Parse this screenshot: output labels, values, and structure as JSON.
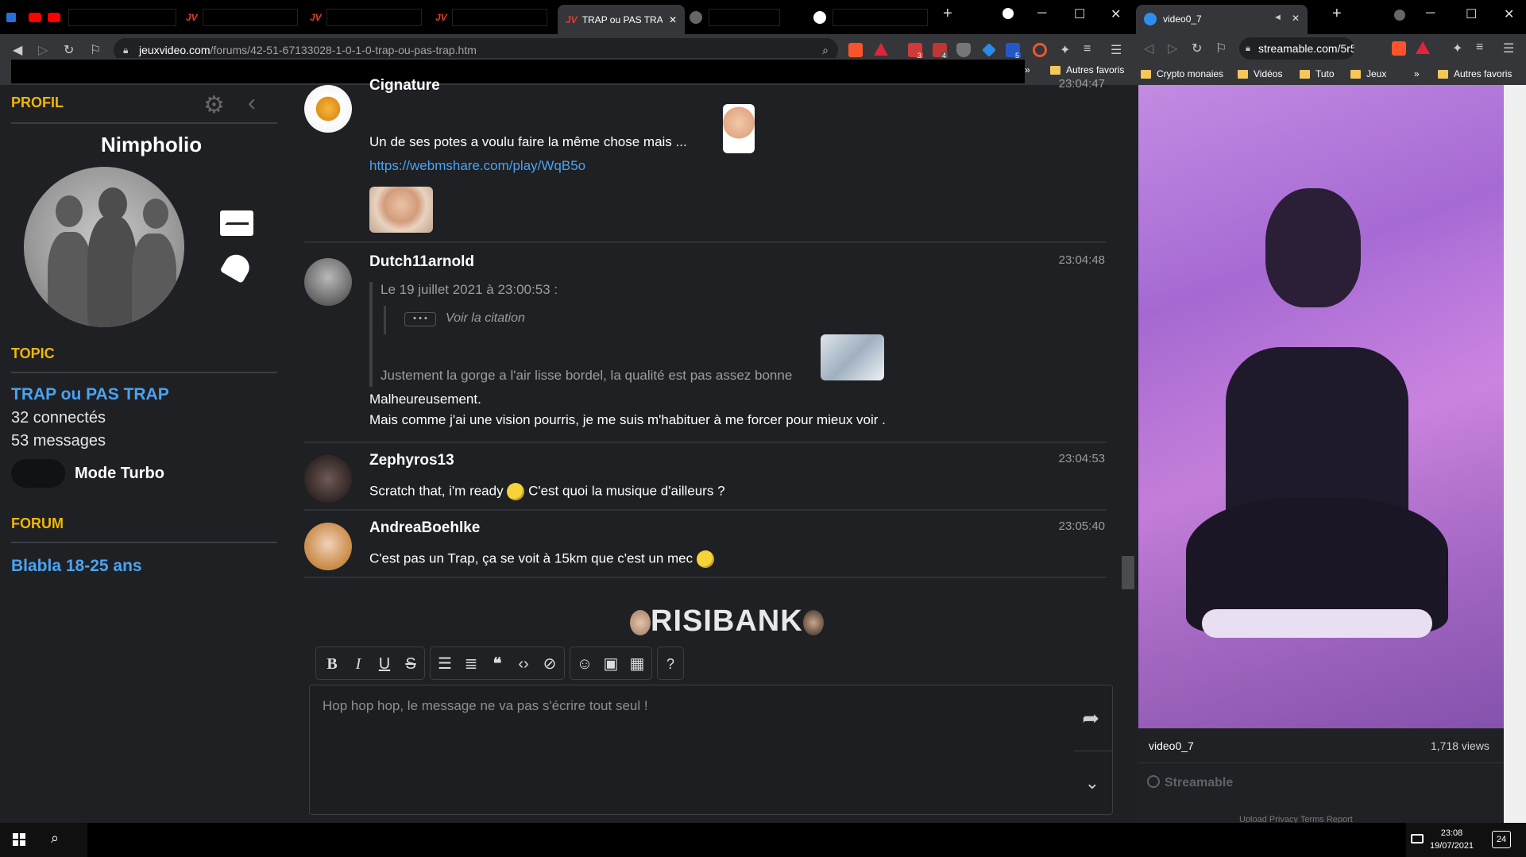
{
  "left_browser": {
    "tabs": [
      {
        "label": "",
        "icon": "jv-icon",
        "color": "#3b6fd9"
      },
      {
        "label": "",
        "icon": "jv-icon",
        "color": "#3b6fd9"
      },
      {
        "label": "",
        "icon": "jv-icon",
        "color": "#3b6fd9"
      },
      {
        "label": "TRAP ou PAS TRAP",
        "icon": "jv-icon",
        "color": "#3b6fd9"
      },
      {
        "label": "",
        "icon": "globe-icon",
        "color": "#888888"
      },
      {
        "label": "",
        "icon": "google-icon",
        "color": "#ffffff"
      }
    ],
    "url_host": "jeuxvideo.com",
    "url_path": "/forums/42-51-67133028-1-0-1-0-trap-ou-pas-trap.htm",
    "extension_badges": [
      "3",
      "4",
      "5"
    ],
    "bookmarks": [
      {
        "label": "Autres favoris"
      }
    ]
  },
  "sidebar": {
    "profil_title": "PROFIL",
    "username": "Nimpholio",
    "topic_title": "TOPIC",
    "topic_name": "TRAP ou PAS TRAP",
    "connected": "32 connectés",
    "messages": "53 messages",
    "turbo_label": "Mode Turbo",
    "forum_title": "FORUM",
    "forum_name": "Blabla 18-25 ans"
  },
  "posts": [
    {
      "author": "Cignature",
      "time": "23:04:47",
      "text": "Un de ses potes a voulu faire la même chose mais ...",
      "link": "https://webmshare.com/play/WqB5o"
    },
    {
      "author": "Dutch11arnold",
      "time": "23:04:48",
      "quote_header": "Le 19 juillet 2021 à 23:00:53 :",
      "quote_see": "Voir la citation",
      "quote_dots": "• • •",
      "quote_text": "Justement la gorge a l'air lisse bordel, la qualité est pas assez bonne",
      "line1": "Malheureusement.",
      "line2": "Mais comme j'ai une vision pourris, je me suis m'habituer à me forcer pour mieux voir ."
    },
    {
      "author": "Zephyros13",
      "time": "23:04:53",
      "text_a": "Scratch that, i'm ready",
      "text_b": "C'est quoi la musique d'ailleurs ?"
    },
    {
      "author": "AndreaBoehlke",
      "time": "23:05:40",
      "text": "C'est pas un Trap, ça se voit à 15km que c'est un mec"
    }
  ],
  "editor": {
    "risibank": "RISIBANK",
    "placeholder": "Hop hop hop, le message ne va pas s'écrire tout seul !",
    "tools": [
      "B",
      "I",
      "U",
      "S",
      "list-icon",
      "numbered-list-icon",
      "quote-icon",
      "code-icon",
      "spoiler-icon",
      "smiley-icon",
      "image-icon",
      "video-icon",
      "?"
    ]
  },
  "right_browser": {
    "tab_title": "video0_7",
    "url": "streamable.com/5r5...",
    "bookmarks": [
      {
        "label": "Crypto monaies"
      },
      {
        "label": "Vidéos"
      },
      {
        "label": "Tuto"
      },
      {
        "label": "Jeux"
      },
      {
        "label": "Autres favoris"
      }
    ],
    "video_title": "video0_7",
    "views": "1,718 views",
    "brand": "Streamable",
    "footer": "Upload    Privacy    Terms    Report"
  },
  "taskbar": {
    "time": "23:08",
    "date": "19/07/2021",
    "notifications": "24"
  }
}
